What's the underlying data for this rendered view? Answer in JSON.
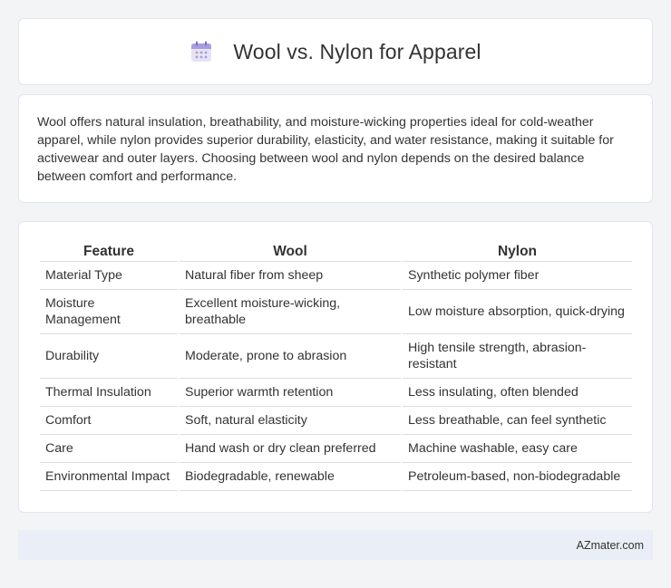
{
  "header": {
    "title": "Wool vs. Nylon for Apparel",
    "icon": "calendar-icon"
  },
  "summary": {
    "text": "Wool offers natural insulation, breathability, and moisture-wicking properties ideal for cold-weather apparel, while nylon provides superior durability, elasticity, and water resistance, making it suitable for activewear and outer layers. Choosing between wool and nylon depends on the desired balance between comfort and performance."
  },
  "table": {
    "headers": [
      "Feature",
      "Wool",
      "Nylon"
    ],
    "rows": [
      [
        "Material Type",
        "Natural fiber from sheep",
        "Synthetic polymer fiber"
      ],
      [
        "Moisture Management",
        "Excellent moisture-wicking, breathable",
        "Low moisture absorption, quick-drying"
      ],
      [
        "Durability",
        "Moderate, prone to abrasion",
        "High tensile strength, abrasion-resistant"
      ],
      [
        "Thermal Insulation",
        "Superior warmth retention",
        "Less insulating, often blended"
      ],
      [
        "Comfort",
        "Soft, natural elasticity",
        "Less breathable, can feel synthetic"
      ],
      [
        "Care",
        "Hand wash or dry clean preferred",
        "Machine washable, easy care"
      ],
      [
        "Environmental Impact",
        "Biodegradable, renewable",
        "Petroleum-based, non-biodegradable"
      ]
    ]
  },
  "footer": {
    "text": "AZmater.com"
  }
}
